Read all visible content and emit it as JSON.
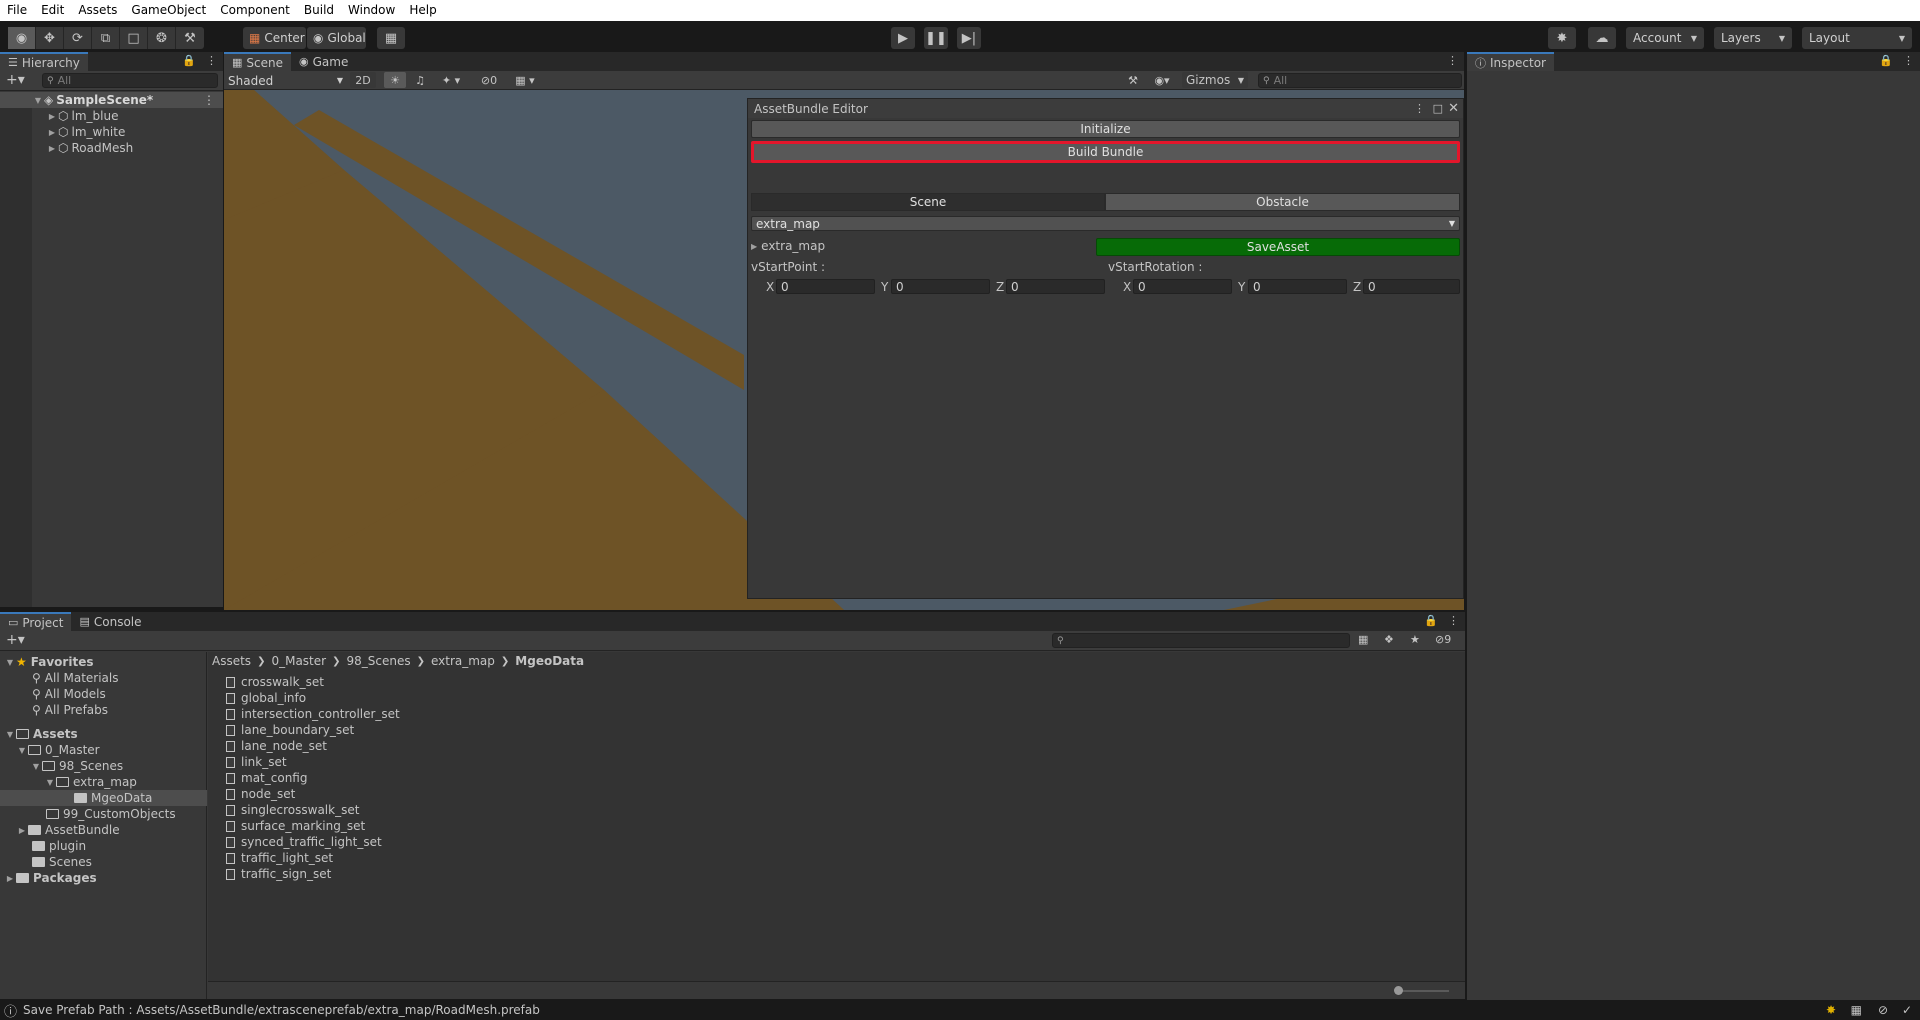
{
  "menu": [
    "File",
    "Edit",
    "Assets",
    "GameObject",
    "Component",
    "Build",
    "Window",
    "Help"
  ],
  "toolbar": {
    "pivot_label": "Center",
    "space_label": "Global",
    "account_label": "Account",
    "layers_label": "Layers",
    "layout_label": "Layout"
  },
  "hierarchy": {
    "tab_label": "Hierarchy",
    "search_placeholder": "All",
    "scene_name": "SampleScene*",
    "items": [
      "lm_blue",
      "lm_white",
      "RoadMesh"
    ]
  },
  "scene_view": {
    "tabs": [
      "Scene",
      "Game"
    ],
    "shading_mode": "Shaded",
    "mode_2d": "2D",
    "hidden_count": "0",
    "gizmos_label": "Gizmos",
    "search_placeholder": "All"
  },
  "inspector": {
    "tab_label": "Inspector"
  },
  "assetbundle_editor": {
    "title": "AssetBundle Editor",
    "initialize_label": "Initialize",
    "build_bundle_label": "Build Bundle",
    "segments": [
      "Scene",
      "Obstacle"
    ],
    "selected_map": "extra_map",
    "foldout_label": "extra_map",
    "save_asset_label": "SaveAsset",
    "start_point_label": "vStartPoint :",
    "start_rotation_label": "vStartRotation :",
    "axis_labels": [
      "X",
      "Y",
      "Z"
    ],
    "start_point": [
      "0",
      "0",
      "0"
    ],
    "start_rotation": [
      "0",
      "0",
      "0"
    ]
  },
  "project": {
    "tabs": [
      "Project",
      "Console"
    ],
    "hidden_count": "9",
    "favorites_label": "Favorites",
    "favorites": [
      "All Materials",
      "All Models",
      "All Prefabs"
    ],
    "assets_label": "Assets",
    "tree": [
      "0_Master",
      "98_Scenes",
      "extra_map",
      "MgeoData",
      "99_CustomObjects",
      "AssetBundle",
      "plugin",
      "Scenes"
    ],
    "packages_label": "Packages",
    "breadcrumb": [
      "Assets",
      "0_Master",
      "98_Scenes",
      "extra_map",
      "MgeoData"
    ],
    "files": [
      "crosswalk_set",
      "global_info",
      "intersection_controller_set",
      "lane_boundary_set",
      "lane_node_set",
      "link_set",
      "mat_config",
      "node_set",
      "singlecrosswalk_set",
      "surface_marking_set",
      "synced_traffic_light_set",
      "traffic_light_set",
      "traffic_sign_set"
    ]
  },
  "status": {
    "message": "Save Prefab Path : Assets/AssetBundle/extrasceneprefab/extra_map/RoadMesh.prefab"
  },
  "colors": {
    "save_asset_green": "#076b07",
    "highlight_red": "#e3162b",
    "tab_accent": "#3a79bb"
  }
}
